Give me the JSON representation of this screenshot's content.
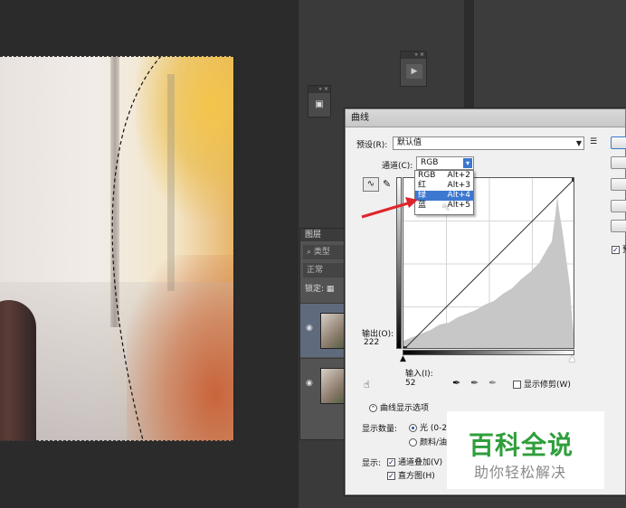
{
  "colors": {
    "accent": "#3c78d0",
    "arrow": "#e0252a",
    "watermark_green": "#2f9e3c"
  },
  "panels": {
    "layers_tab": "图层",
    "search_kind": "类型",
    "blend_mode": "正常",
    "lock_label": "锁定:"
  },
  "dialog": {
    "title": "曲线",
    "preset_label": "预设(R):",
    "preset_value": "默认值",
    "channel_label": "通道(C):",
    "channel_value": "RGB",
    "channel_menu": [
      {
        "label": "RGB",
        "shortcut": "Alt+2"
      },
      {
        "label": "红",
        "shortcut": "Alt+3"
      },
      {
        "label": "绿",
        "shortcut": "Alt+4"
      },
      {
        "label": "蓝",
        "shortcut": "Alt+5"
      }
    ],
    "output_label": "输出(O):",
    "output_value": "222",
    "input_label": "输入(I):",
    "input_value": "52",
    "show_clipping": "显示修剪(W)",
    "curve_options": "曲线显示选项",
    "show_amount_label": "显示数量:",
    "radio_light": "光 (0-25",
    "radio_pigment": "颜料/油",
    "show_label": "显示:",
    "chk_channel_overlay": "通道叠加(V)",
    "chk_histogram": "直方图(H)",
    "side_preview": "预"
  },
  "watermark": {
    "line1": "百科全说",
    "line2": "助你轻松解决"
  }
}
